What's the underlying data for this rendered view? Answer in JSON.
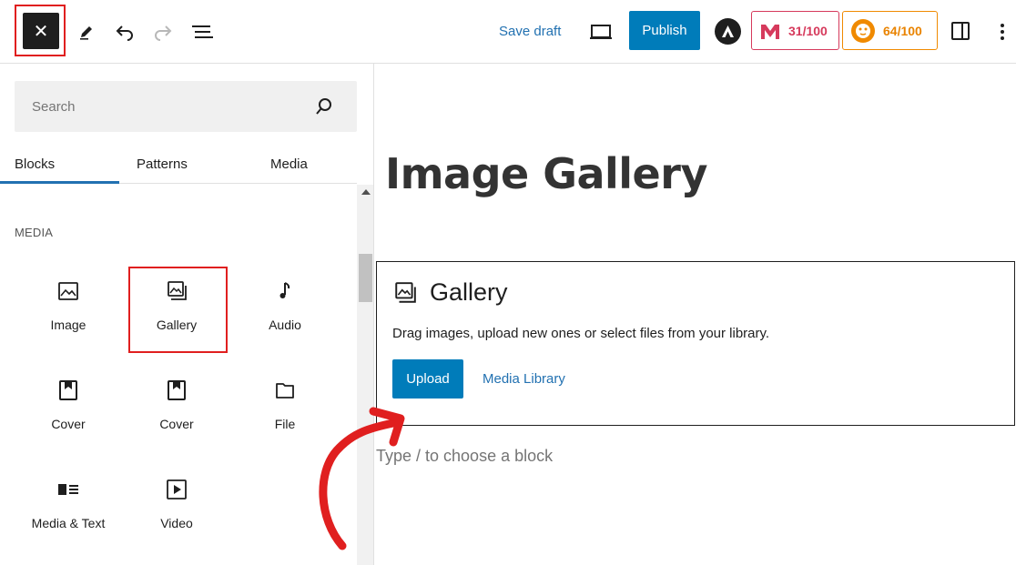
{
  "toolbar": {
    "save_draft_label": "Save draft",
    "publish_label": "Publish",
    "score_badges": [
      {
        "value": "31/100",
        "color": "#d63a5c"
      },
      {
        "value": "64/100",
        "color": "#e98300"
      }
    ]
  },
  "inserter": {
    "search_placeholder": "Search",
    "tabs": [
      {
        "label": "Blocks",
        "active": true
      },
      {
        "label": "Patterns",
        "active": false
      },
      {
        "label": "Media",
        "active": false
      }
    ],
    "section_title": "MEDIA",
    "blocks": [
      {
        "label": "Image",
        "icon": "image-icon"
      },
      {
        "label": "Gallery",
        "icon": "gallery-icon",
        "highlighted": true
      },
      {
        "label": "Audio",
        "icon": "audio-icon"
      },
      {
        "label": "Cover",
        "icon": "cover-icon"
      },
      {
        "label": "Cover",
        "icon": "cover-icon"
      },
      {
        "label": "File",
        "icon": "file-icon"
      },
      {
        "label": "Media & Text",
        "icon": "media-text-icon"
      },
      {
        "label": "Video",
        "icon": "video-icon"
      }
    ]
  },
  "editor": {
    "post_title": "Image Gallery",
    "gallery_block": {
      "title": "Gallery",
      "instructions": "Drag images, upload new ones or select files from your library.",
      "upload_label": "Upload",
      "media_library_label": "Media Library"
    },
    "appender_placeholder": "Type / to choose a block"
  },
  "colors": {
    "accent": "#007cba",
    "link": "#2271b1",
    "annotation": "#e01f1f"
  }
}
